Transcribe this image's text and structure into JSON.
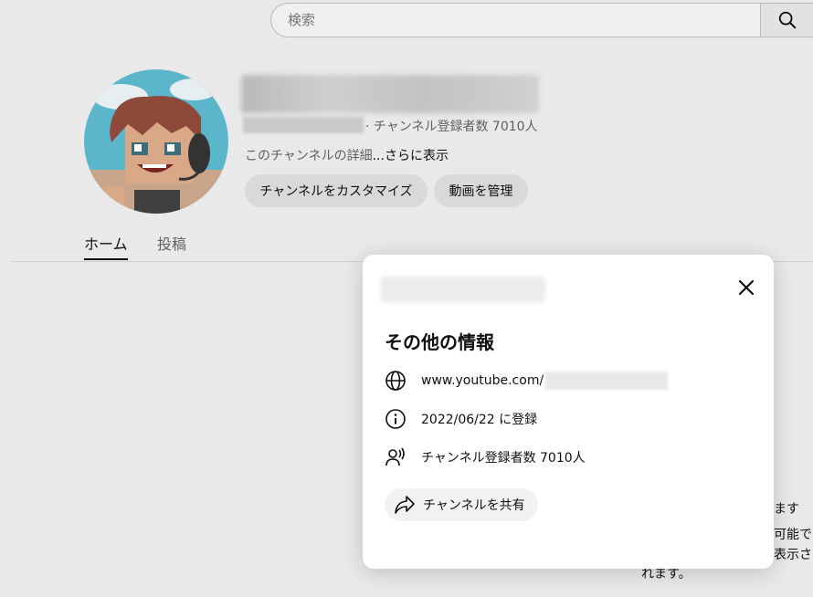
{
  "search": {
    "placeholder": "検索"
  },
  "channel": {
    "subscribers_text": "· チャンネル登録者数 7010人",
    "description": "このチャンネルの詳細",
    "more_link": "...さらに表示",
    "customize_label": "チャンネルをカスタマイズ",
    "manage_videos_label": "動画を管理"
  },
  "tabs": [
    {
      "label": "ホーム",
      "selected": true
    },
    {
      "label": "投稿",
      "selected": false
    }
  ],
  "background_snippets": [
    "ます",
    "可能で",
    "表示さ",
    "れます。"
  ],
  "about_dialog": {
    "heading": "その他の情報",
    "url_prefix": "www.youtube.com/",
    "joined": "2022/06/22 に登録",
    "subscribers": "チャンネル登録者数 7010人",
    "share_label": "チャンネルを共有",
    "icons": [
      "globe-icon",
      "info-icon",
      "subscribers-icon",
      "share-icon",
      "close-icon"
    ]
  },
  "colors": {
    "background": "#e9e9e9",
    "dialog": "#ffffff",
    "pill": "#d9d9d9",
    "share_pill": "#f2f2f2"
  }
}
